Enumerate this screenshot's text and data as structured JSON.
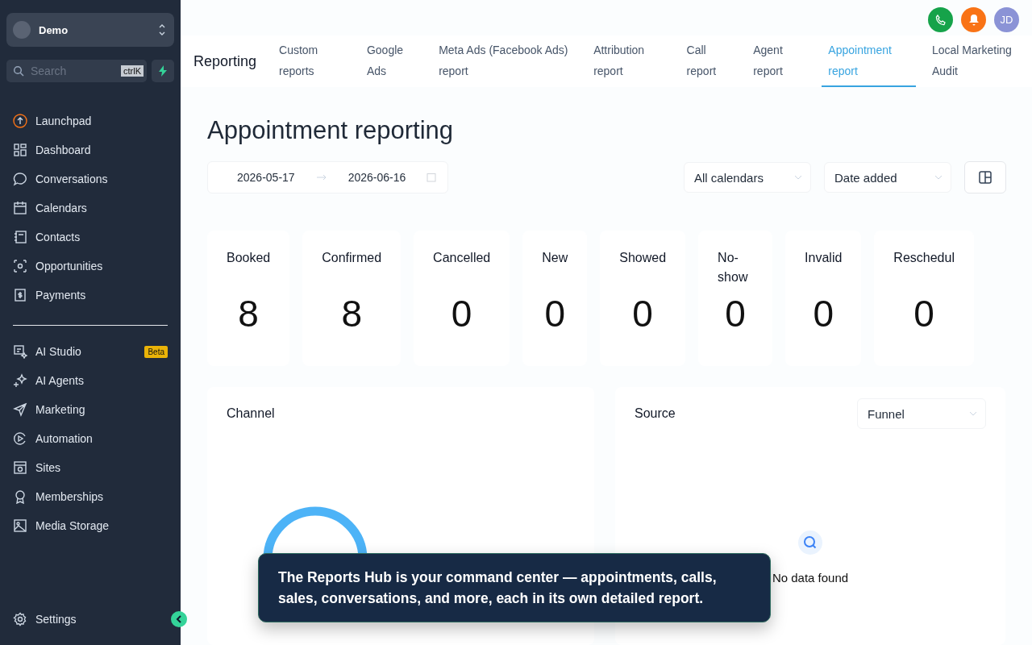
{
  "sidebar": {
    "account": {
      "name": "Demo"
    },
    "search": {
      "placeholder": "Search",
      "shortcut": "ctrlK"
    },
    "items": [
      {
        "label": "Launchpad"
      },
      {
        "label": "Dashboard"
      },
      {
        "label": "Conversations"
      },
      {
        "label": "Calendars"
      },
      {
        "label": "Contacts"
      },
      {
        "label": "Opportunities"
      },
      {
        "label": "Payments"
      }
    ],
    "items_2": [
      {
        "label": "AI Studio",
        "badge": "Beta"
      },
      {
        "label": "AI Agents"
      },
      {
        "label": "Marketing"
      },
      {
        "label": "Automation"
      },
      {
        "label": "Sites"
      },
      {
        "label": "Memberships"
      },
      {
        "label": "Media Storage"
      }
    ],
    "settings": "Settings"
  },
  "header": {
    "avatar": "JD"
  },
  "nav": {
    "title": "Reporting",
    "tabs": [
      {
        "label": "Custom reports",
        "selected": false
      },
      {
        "label": "Google Ads",
        "selected": false
      },
      {
        "label": "Meta Ads (Facebook Ads) report",
        "selected": false
      },
      {
        "label": "Attribution report",
        "selected": false
      },
      {
        "label": "Call report",
        "selected": false
      },
      {
        "label": "Agent report",
        "selected": false
      },
      {
        "label": "Appointment report",
        "selected": true
      },
      {
        "label": "Local Marketing Audit",
        "selected": false
      }
    ]
  },
  "page_title": "Appointment reporting",
  "filters": {
    "date_from": "2026-05-17",
    "date_to": "2026-06-16",
    "calendar": "All calendars",
    "date_type": "Date added"
  },
  "stats": [
    {
      "label": "Booked",
      "value": "8"
    },
    {
      "label": "Confirmed",
      "value": "8"
    },
    {
      "label": "Cancelled",
      "value": "0"
    },
    {
      "label": "New",
      "value": "0"
    },
    {
      "label": "Showed",
      "value": "0"
    },
    {
      "label": "No-show",
      "value": "0"
    },
    {
      "label": "Invalid",
      "value": "0"
    },
    {
      "label": "Reschedul",
      "value": "0"
    }
  ],
  "channel": {
    "title": "Channel"
  },
  "source": {
    "title": "Source",
    "filter": "Funnel",
    "empty": "No data found"
  },
  "tooltip": {
    "text": "The Reports Hub is your command center — appointments, calls, sales, conversations, and more, each in its own detailed report."
  }
}
